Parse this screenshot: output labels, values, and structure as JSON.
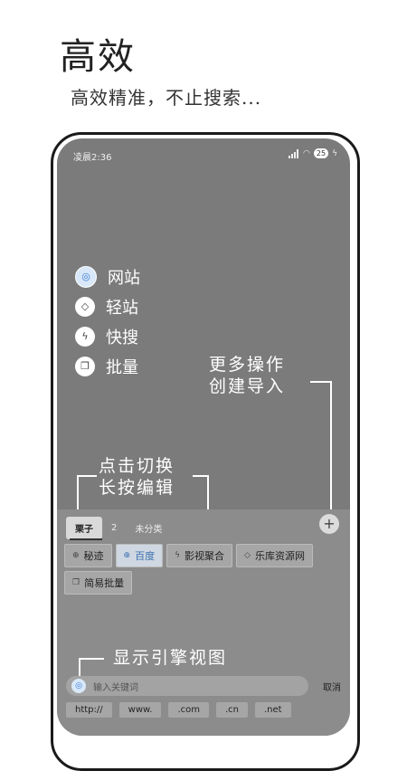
{
  "hero": {
    "title": "高效",
    "subtitle": "高效精准，不止搜索..."
  },
  "status": {
    "time": "凌晨2:36",
    "battery": "25"
  },
  "menu": [
    {
      "label": "网站",
      "icon": "globe-icon",
      "glyph": "◎"
    },
    {
      "label": "轻站",
      "icon": "cube-icon",
      "glyph": "◇"
    },
    {
      "label": "快搜",
      "icon": "bolt-icon",
      "glyph": "ϟ"
    },
    {
      "label": "批量",
      "icon": "copy-icon",
      "glyph": "❐"
    }
  ],
  "annotations": {
    "more_ops_line1": "更多操作",
    "more_ops_line2": "创建导入",
    "tap_line1": "点击切换",
    "tap_line2": "长按编辑",
    "engine_view": "显示引擎视图"
  },
  "tabs": [
    "栗子",
    "2",
    "未分类"
  ],
  "add_label": "+",
  "chips": [
    {
      "label": "秘迹",
      "icon": "globe-icon",
      "glyph": "⊕"
    },
    {
      "label": "百度",
      "icon": "globe-icon",
      "glyph": "⊕",
      "selected": true
    },
    {
      "label": "影视聚合",
      "icon": "bolt-icon",
      "glyph": "ϟ"
    },
    {
      "label": "乐库资源网",
      "icon": "cube-icon",
      "glyph": "◇"
    },
    {
      "label": "简易批量",
      "icon": "copy-icon",
      "glyph": "❐"
    }
  ],
  "search": {
    "placeholder": "输入关键词",
    "cancel": "取消"
  },
  "suffixes": [
    "http://",
    "www.",
    ".com",
    ".cn",
    ".net"
  ]
}
